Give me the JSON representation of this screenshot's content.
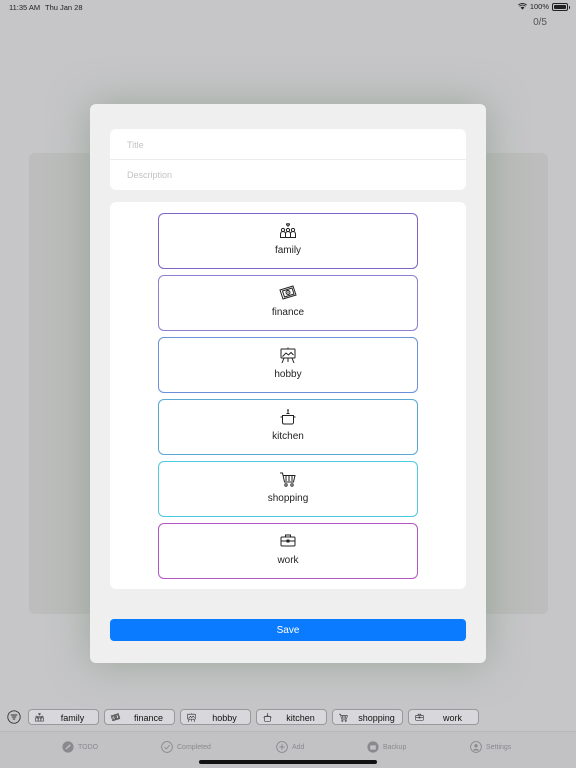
{
  "status_bar": {
    "time": "11:35 AM",
    "date": "Thu Jan 28",
    "battery": "100%"
  },
  "counter": "0/5",
  "form": {
    "title_placeholder": "Title",
    "description_placeholder": "Description",
    "save_label": "Save"
  },
  "categories": [
    {
      "label": "family",
      "icon": "family-icon",
      "color": "#7f63c6"
    },
    {
      "label": "finance",
      "icon": "money-icon",
      "color": "#8c7ed0"
    },
    {
      "label": "hobby",
      "icon": "easel-icon",
      "color": "#6f8fda"
    },
    {
      "label": "kitchen",
      "icon": "cooking-pot-icon",
      "color": "#58a8d2"
    },
    {
      "label": "shopping",
      "icon": "shopping-cart-icon",
      "color": "#4ec9e3"
    },
    {
      "label": "work",
      "icon": "briefcase-icon",
      "color": "#b455c8"
    }
  ],
  "filter_chips": [
    {
      "label": "family",
      "icon": "family-icon"
    },
    {
      "label": "finance",
      "icon": "money-icon"
    },
    {
      "label": "hobby",
      "icon": "easel-icon"
    },
    {
      "label": "kitchen",
      "icon": "cooking-pot-icon"
    },
    {
      "label": "shopping",
      "icon": "shopping-cart-icon"
    },
    {
      "label": "work",
      "icon": "briefcase-icon"
    }
  ],
  "tabs": [
    {
      "label": "TODO",
      "icon": "pencil-icon"
    },
    {
      "label": "Completed",
      "icon": "checkmark-icon"
    },
    {
      "label": "Add",
      "icon": "plus-icon"
    },
    {
      "label": "Backup",
      "icon": "archive-icon"
    },
    {
      "label": "Settings",
      "icon": "person-icon"
    }
  ],
  "colors": {
    "accent": "#0a7aff",
    "background": "#c6c6c8",
    "modal": "#efeff0"
  }
}
